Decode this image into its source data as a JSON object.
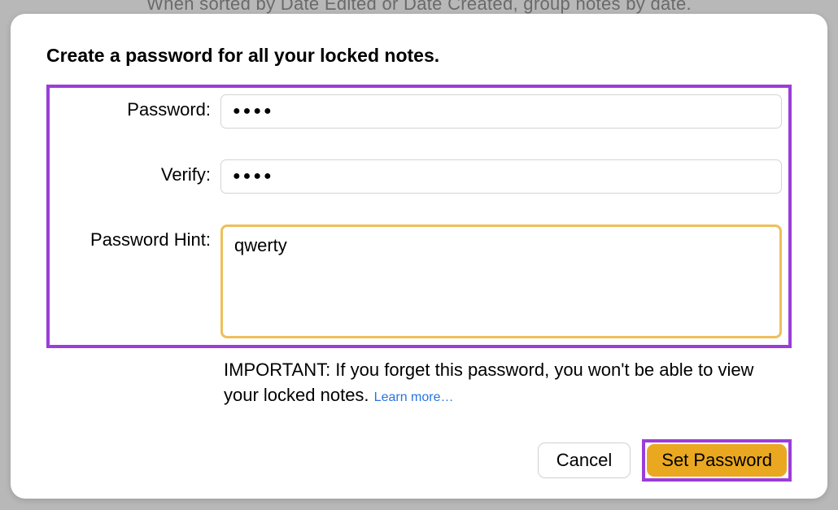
{
  "background": {
    "text": "When sorted by Date Edited or Date Created, group notes by date."
  },
  "dialog": {
    "title": "Create a password for all your locked notes.",
    "fields": {
      "password": {
        "label": "Password:",
        "value": "●●●●"
      },
      "verify": {
        "label": "Verify:",
        "value": "●●●●"
      },
      "hint": {
        "label": "Password Hint:",
        "value": "qwerty"
      }
    },
    "info": {
      "text": "IMPORTANT: If you forget this password, you won't be able to view your locked notes. ",
      "link": "Learn more…"
    },
    "buttons": {
      "cancel": "Cancel",
      "confirm": "Set Password"
    }
  },
  "annotations": {
    "form_highlight_color": "#9b3dd9",
    "hint_focus_color": "#eebf5a",
    "confirm_highlight_color": "#9b3dd9"
  }
}
